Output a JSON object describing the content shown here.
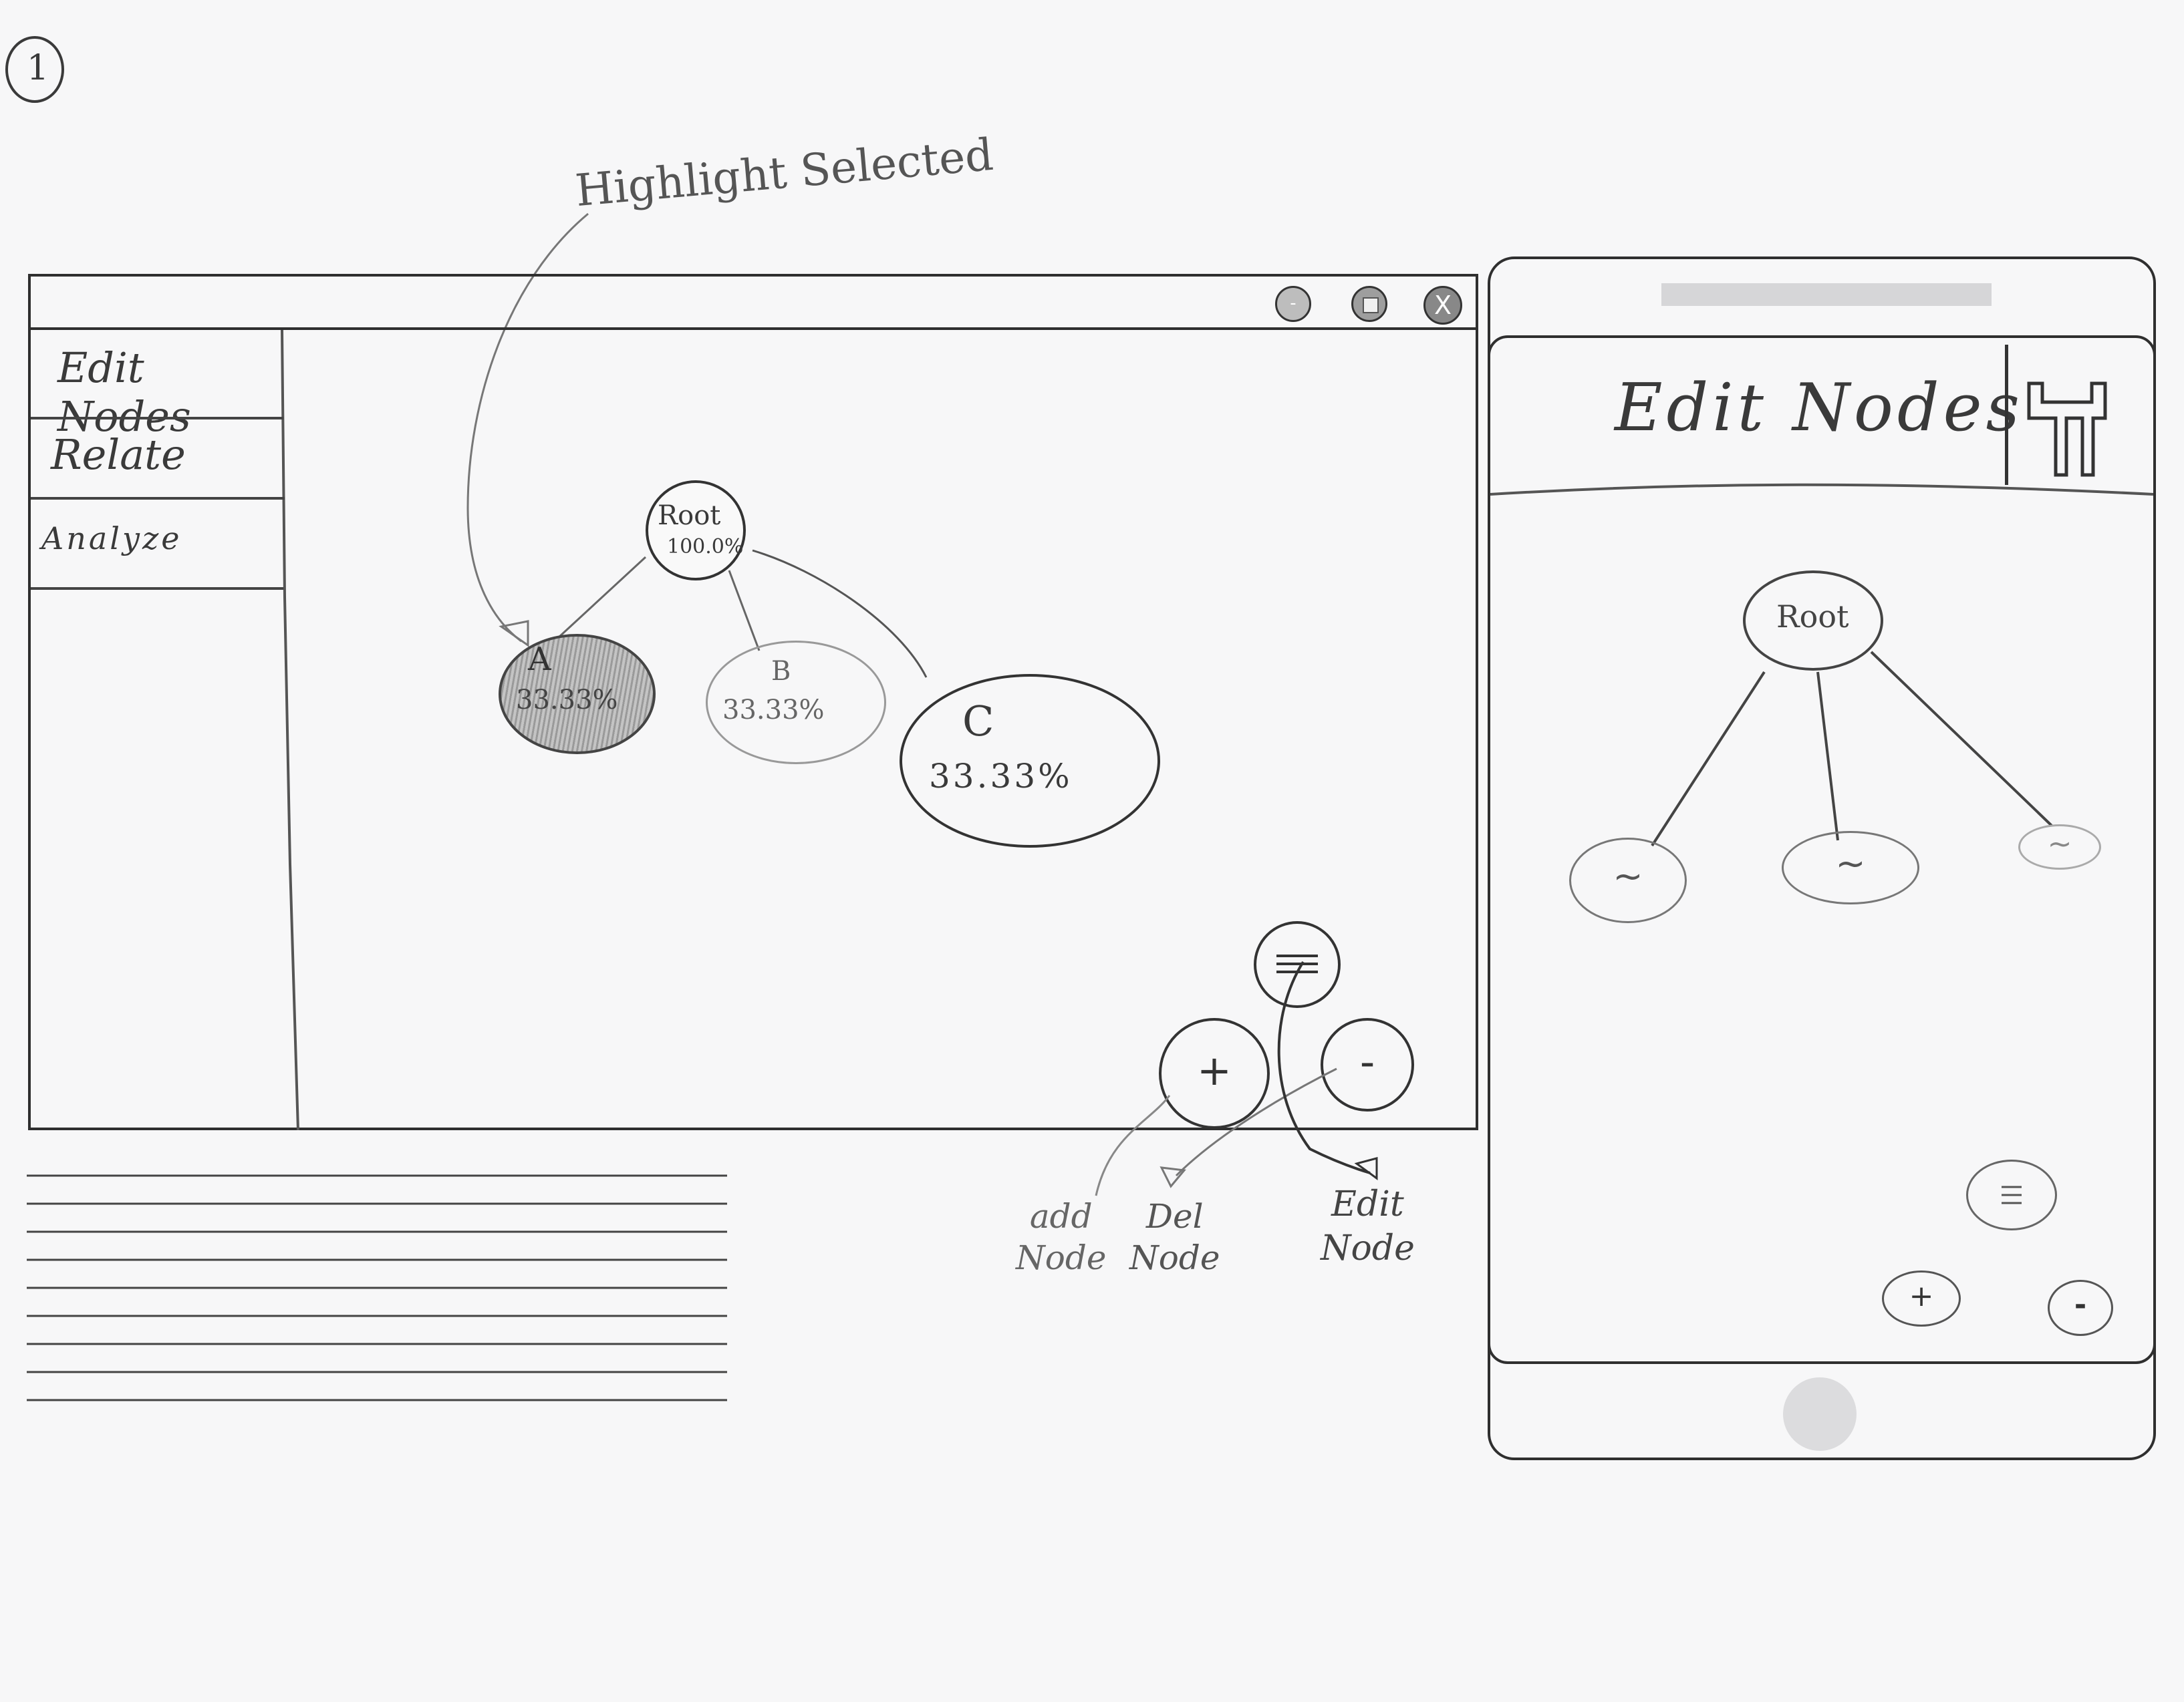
{
  "page": {
    "number": "1"
  },
  "annotations": {
    "highlight": "Highlight Selected",
    "add_node": [
      "add",
      "Node"
    ],
    "del_node": [
      "Del",
      "Node"
    ],
    "edit_node": [
      "Edit",
      "Node"
    ]
  },
  "desktop": {
    "window_controls": {
      "minimize": "-",
      "restore": "",
      "close": "X"
    },
    "sidebar": {
      "items": [
        {
          "label": "Edit Nodes"
        },
        {
          "label": "Relate"
        },
        {
          "label": "Analyze"
        }
      ]
    },
    "tree": {
      "root": {
        "label": "Root",
        "value": "100.0%"
      },
      "children": [
        {
          "label": "A",
          "value": "33.33%",
          "selected": true
        },
        {
          "label": "B",
          "value": "33.33%"
        },
        {
          "label": "C",
          "value": "33.33%"
        }
      ]
    },
    "fab": {
      "menu_icon": "menu-icon",
      "add": "+",
      "remove": "-"
    }
  },
  "mobile": {
    "header_title": "Edit Nodes",
    "header_icon": "wrench-icon",
    "tree": {
      "root": {
        "label": "Root"
      },
      "children": [
        {
          "label": "~"
        },
        {
          "label": "~"
        },
        {
          "label": "~"
        }
      ]
    },
    "fab": {
      "menu_icon": "menu-icon",
      "add": "+",
      "remove": "-"
    }
  },
  "colors": {
    "pencil": "#3a3a3a",
    "paper": "#f7f7f8",
    "light_gray": "#d6d6d8"
  }
}
